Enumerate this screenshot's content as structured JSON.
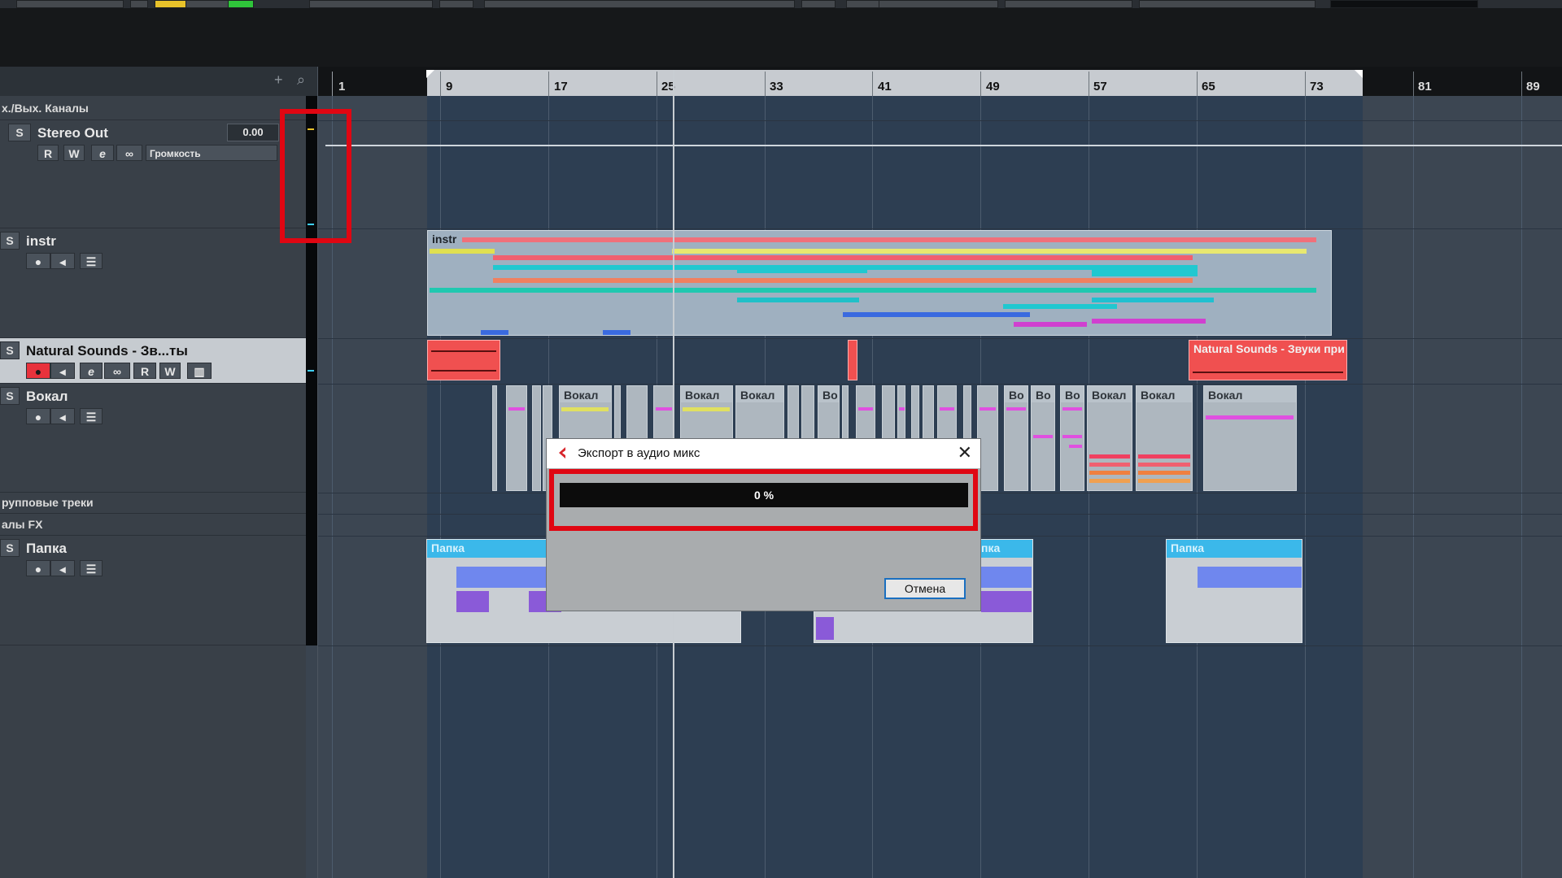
{
  "track_list": {
    "folders": {
      "io_channels": "х./Вых. Каналы",
      "group_tracks": "рупповые треки",
      "fx_channels": "алы FX"
    },
    "tracks": [
      {
        "name": "Stereo Out",
        "volume_value": "0.00",
        "volume_label": "Громкость",
        "buttons": [
          "S",
          "R",
          "W"
        ]
      },
      {
        "name": "instr",
        "buttons": [
          "S"
        ]
      },
      {
        "name": "Natural Sounds - Зв...ты",
        "buttons": [
          "S",
          "R",
          "W"
        ]
      },
      {
        "name": "Вокал",
        "buttons": [
          "S"
        ]
      },
      {
        "name": "Папка",
        "buttons": [
          "S"
        ]
      }
    ]
  },
  "ruler": {
    "bars": [
      "1",
      "9",
      "17",
      "25",
      "33",
      "41",
      "49",
      "57",
      "65",
      "73",
      "81",
      "89"
    ]
  },
  "parts": {
    "instr_label": "instr",
    "natural_sounds_label": "Natural Sounds - Звуки при",
    "vocal_label": "Вокал",
    "vocal_short": "Во",
    "vocal_tiny": "Во",
    "folder_label": "Папка",
    "folder_label_partial": "пка"
  },
  "dialog": {
    "title": "Экспорт в аудио микс",
    "progress_text": "0 %",
    "progress_value": 0,
    "cancel_label": "Отмена"
  },
  "colors": {
    "accent_red": "#e00612",
    "range_blue": "#2d3e52",
    "progress_bg": "#0c0c0c"
  }
}
